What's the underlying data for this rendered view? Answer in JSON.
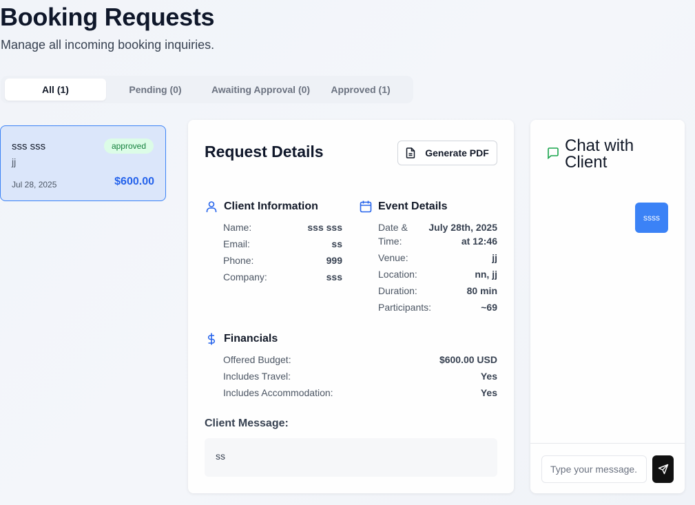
{
  "header": {
    "title": "Booking Requests",
    "subtitle": "Manage all incoming booking inquiries."
  },
  "tabs": [
    {
      "label": "All (1)",
      "active": true
    },
    {
      "label": "Pending (0)",
      "active": false
    },
    {
      "label": "Awaiting Approval (0)",
      "active": false
    },
    {
      "label": "Approved (1)",
      "active": false
    }
  ],
  "requests": [
    {
      "name": "sss sss",
      "venue": "jj",
      "status": "approved",
      "date": "Jul 28, 2025",
      "amount": "$600.00"
    }
  ],
  "details": {
    "title": "Request Details",
    "pdf_button": "Generate PDF",
    "client": {
      "heading": "Client Information",
      "icon": "user-icon",
      "fields": [
        {
          "label": "Name:",
          "value": "sss sss"
        },
        {
          "label": "Email:",
          "value": "ss"
        },
        {
          "label": "Phone:",
          "value": "999"
        },
        {
          "label": "Company:",
          "value": "sss"
        }
      ]
    },
    "event": {
      "heading": "Event Details",
      "icon": "calendar-icon",
      "fields": [
        {
          "label": "Date & Time:",
          "value": "July 28th, 2025 at 12:46"
        },
        {
          "label": "Venue:",
          "value": "jj"
        },
        {
          "label": "Location:",
          "value": "nn, jj"
        },
        {
          "label": "Duration:",
          "value": "80 min"
        },
        {
          "label": "Participants:",
          "value": "~69"
        }
      ]
    },
    "financials": {
      "heading": "Financials",
      "icon": "dollar-icon",
      "fields": [
        {
          "label": "Offered Budget:",
          "value": "$600.00 USD"
        },
        {
          "label": "Includes Travel:",
          "value": "Yes"
        },
        {
          "label": "Includes Accommodation:",
          "value": "Yes"
        }
      ]
    },
    "message_label": "Client Message:",
    "message": "ss"
  },
  "chat": {
    "title": "Chat with Client",
    "icon": "message-icon",
    "messages": [
      {
        "text": "ssss",
        "from": "me"
      }
    ],
    "input_placeholder": "Type your message...",
    "send_icon": "send-icon"
  },
  "colors": {
    "accent": "#3b82f6",
    "price": "#2563eb",
    "badge_bg": "#dcfce7",
    "badge_text": "#15803d",
    "icon_blue": "#2563eb",
    "icon_green": "#16a34a"
  }
}
